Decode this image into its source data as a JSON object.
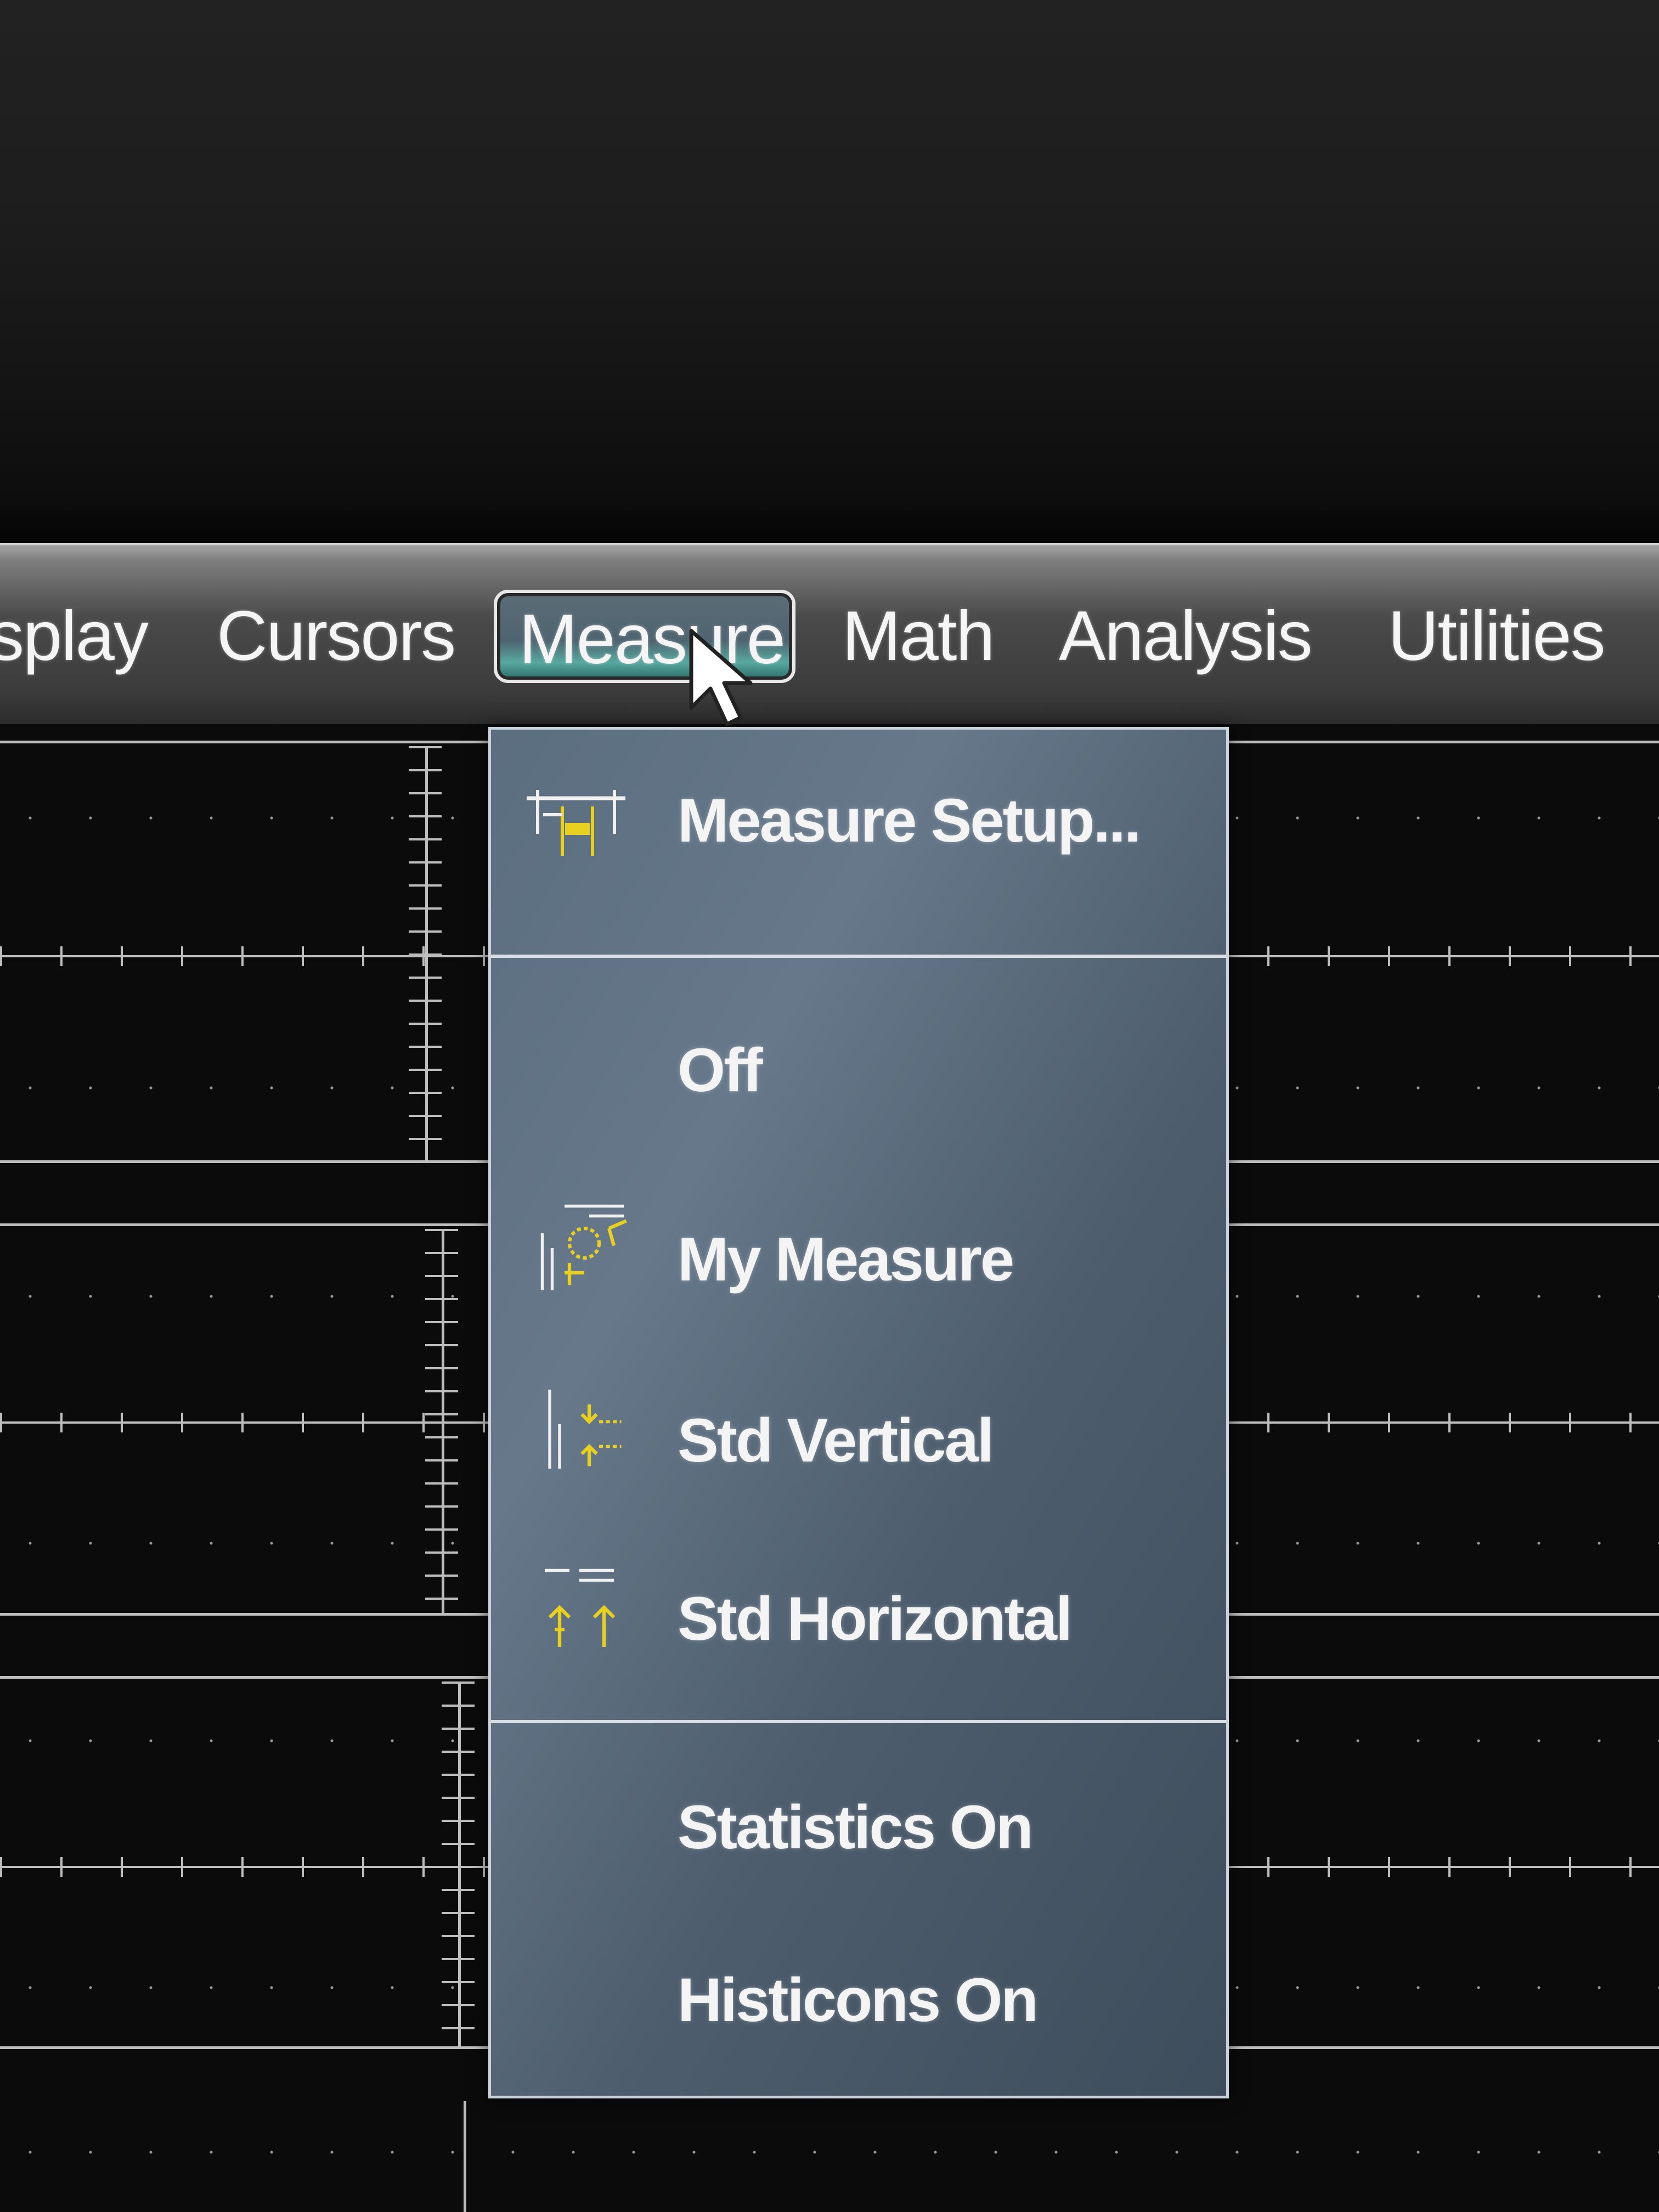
{
  "menubar": {
    "items": [
      {
        "label": "splay"
      },
      {
        "label": "Cursors"
      },
      {
        "label": "Measure"
      },
      {
        "label": "Math"
      },
      {
        "label": "Analysis"
      },
      {
        "label": "Utilities"
      }
    ],
    "active_index": 2
  },
  "dropdown": {
    "items": [
      {
        "label": "Measure Setup...",
        "icon": "measure-setup-icon"
      },
      {
        "label": "Off",
        "icon": ""
      },
      {
        "label": "My Measure",
        "icon": "my-measure-icon"
      },
      {
        "label": "Std Vertical",
        "icon": "std-vertical-icon"
      },
      {
        "label": "Std Horizontal",
        "icon": "std-horizontal-icon"
      },
      {
        "label": "Statistics On",
        "icon": ""
      },
      {
        "label": "Histicons On",
        "icon": ""
      }
    ]
  },
  "colors": {
    "menu_text": "#f5f5f5",
    "dropdown_bg": "#5b6e7f",
    "icon_yellow": "#e8d020",
    "graticule": "#bdbdbd",
    "active_highlight": "#58a8a0"
  }
}
